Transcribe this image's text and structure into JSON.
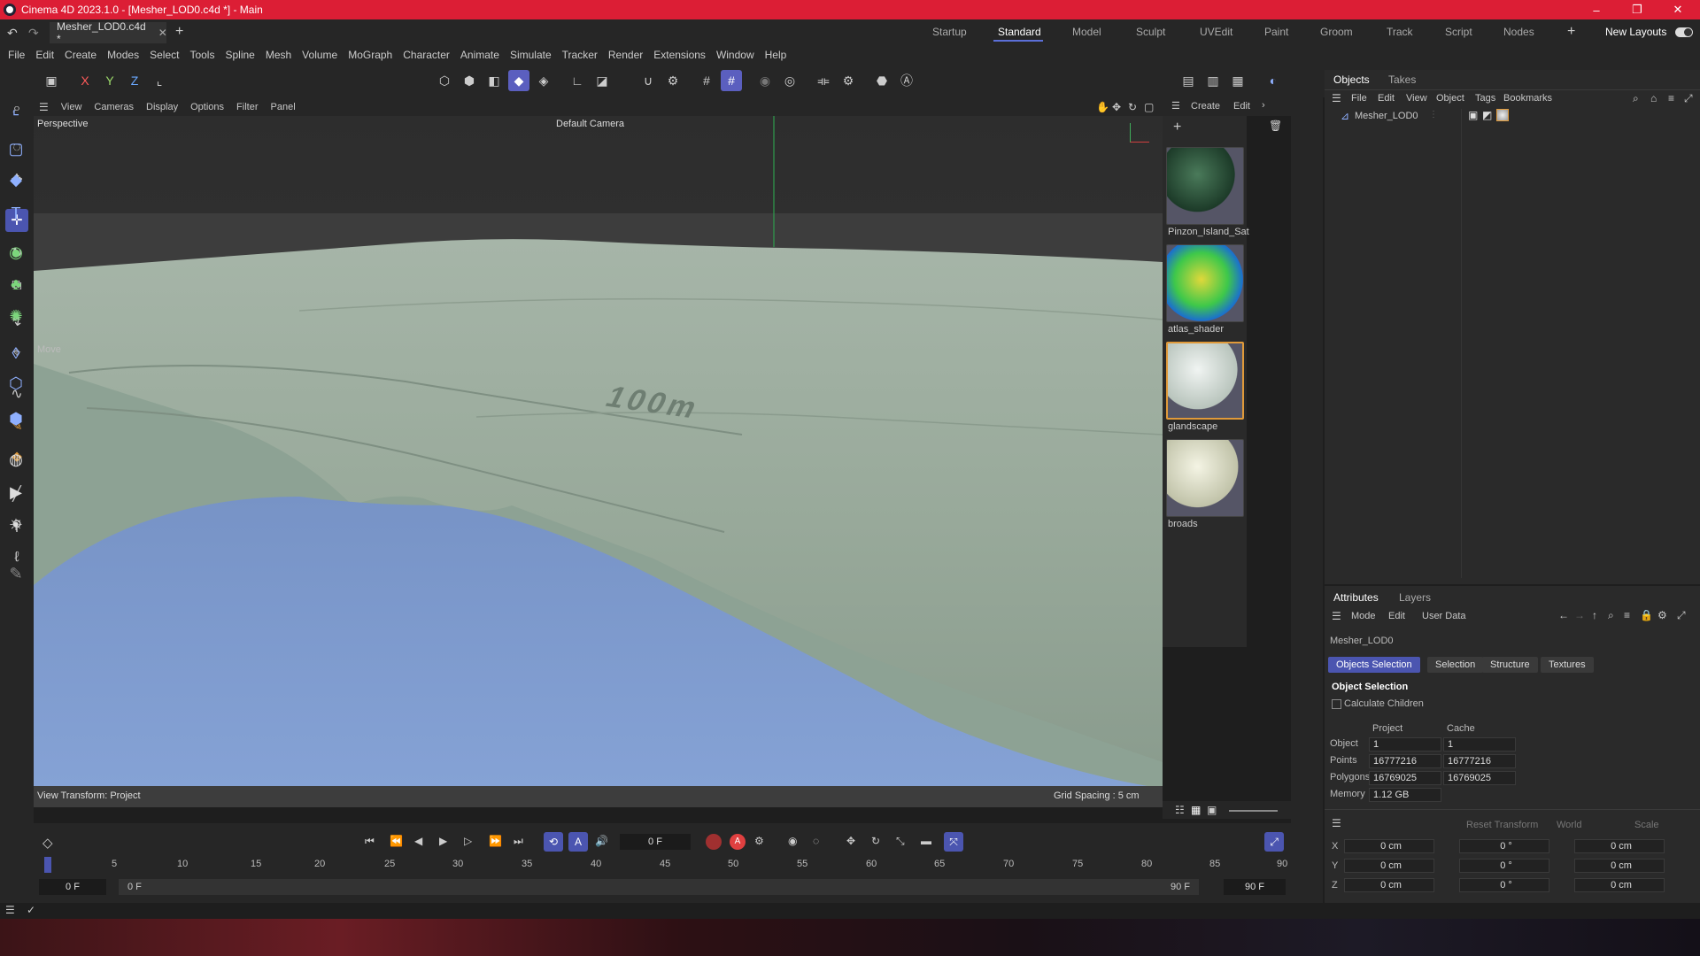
{
  "app": {
    "title": "Cinema 4D 2023.1.0 - [Mesher_LOD0.c4d *] - Main",
    "doc_tab": "Mesher_LOD0.c4d *",
    "window_controls": [
      "–",
      "❐",
      "✕"
    ]
  },
  "layouts": {
    "items": [
      "Startup",
      "Standard",
      "Model",
      "Sculpt",
      "UVEdit",
      "Paint",
      "Groom",
      "Track",
      "Script",
      "Nodes"
    ],
    "active": "Standard",
    "new_layouts_label": "New Layouts"
  },
  "menu": [
    "File",
    "Edit",
    "Create",
    "Modes",
    "Select",
    "Tools",
    "Spline",
    "Mesh",
    "Volume",
    "MoGraph",
    "Character",
    "Animate",
    "Simulate",
    "Tracker",
    "Render",
    "Extensions",
    "Window",
    "Help"
  ],
  "toolbar": {
    "axis_x": "X",
    "axis_y": "Y",
    "axis_z": "Z"
  },
  "viewport": {
    "menu": [
      "View",
      "Cameras",
      "Display",
      "Options",
      "Filter",
      "Panel"
    ],
    "projection": "Perspective",
    "camera": "Default Camera",
    "tool_label": "Move",
    "terrain_text": "100m",
    "view_transform": "View Transform: Project",
    "grid_spacing": "Grid Spacing : 5 cm"
  },
  "materials": {
    "header": [
      "Create",
      "Edit"
    ],
    "items": [
      {
        "name": "Pinzon_Island_Sat",
        "color": "#2e5a3e"
      },
      {
        "name": "atlas_shader",
        "color": "#3ec84a"
      },
      {
        "name": "glandscape",
        "color": "#cfd8d2"
      },
      {
        "name": "broads",
        "color": "#dcdcc4"
      }
    ]
  },
  "objects": {
    "tabs": [
      "Objects",
      "Takes"
    ],
    "menu": [
      "File",
      "Edit",
      "View",
      "Object",
      "Tags",
      "Bookmarks"
    ],
    "tree": [
      {
        "name": "Mesher_LOD0"
      }
    ]
  },
  "attributes": {
    "tabs": [
      "Attributes",
      "Layers"
    ],
    "menu": [
      "Mode",
      "Edit",
      "User Data"
    ],
    "object_name": "Mesher_LOD0",
    "subtabs": [
      "Objects Selection",
      "Selection",
      "Structure",
      "Textures"
    ],
    "active_subtab": "Objects Selection",
    "section_title": "Object Selection",
    "calc_children": "Calculate Children",
    "col_project": "Project",
    "col_cache": "Cache",
    "rows": [
      {
        "label": "Object",
        "project": "1",
        "cache": "1"
      },
      {
        "label": "Points",
        "project": "16777216",
        "cache": "16777216"
      },
      {
        "label": "Polygons",
        "project": "16769025",
        "cache": "16769025"
      },
      {
        "label": "Memory",
        "project": "1.12 GB",
        "cache": ""
      }
    ]
  },
  "coords": {
    "reset_label": "Reset Transform",
    "space": "World",
    "mode": "Scale",
    "rows": [
      {
        "axis": "X",
        "pos": "0 cm",
        "rot": "0 °",
        "scale": "0 cm"
      },
      {
        "axis": "Y",
        "pos": "0 cm",
        "rot": "0 °",
        "scale": "0 cm"
      },
      {
        "axis": "Z",
        "pos": "0 cm",
        "rot": "0 °",
        "scale": "0 cm"
      }
    ]
  },
  "timeline": {
    "current_frame": "0 F",
    "ticks": [
      "0",
      "5",
      "10",
      "15",
      "20",
      "25",
      "30",
      "35",
      "40",
      "45",
      "50",
      "55",
      "60",
      "65",
      "70",
      "75",
      "80",
      "85",
      "90"
    ],
    "start_left": "0 F",
    "start_right": "0 F",
    "end_left": "90 F",
    "end_right": "90 F"
  },
  "colors": {
    "title_bar": "#dc1e35",
    "accent": "#4b55b0",
    "terrain": "#9aab9e",
    "water": "#7c9bd0"
  }
}
